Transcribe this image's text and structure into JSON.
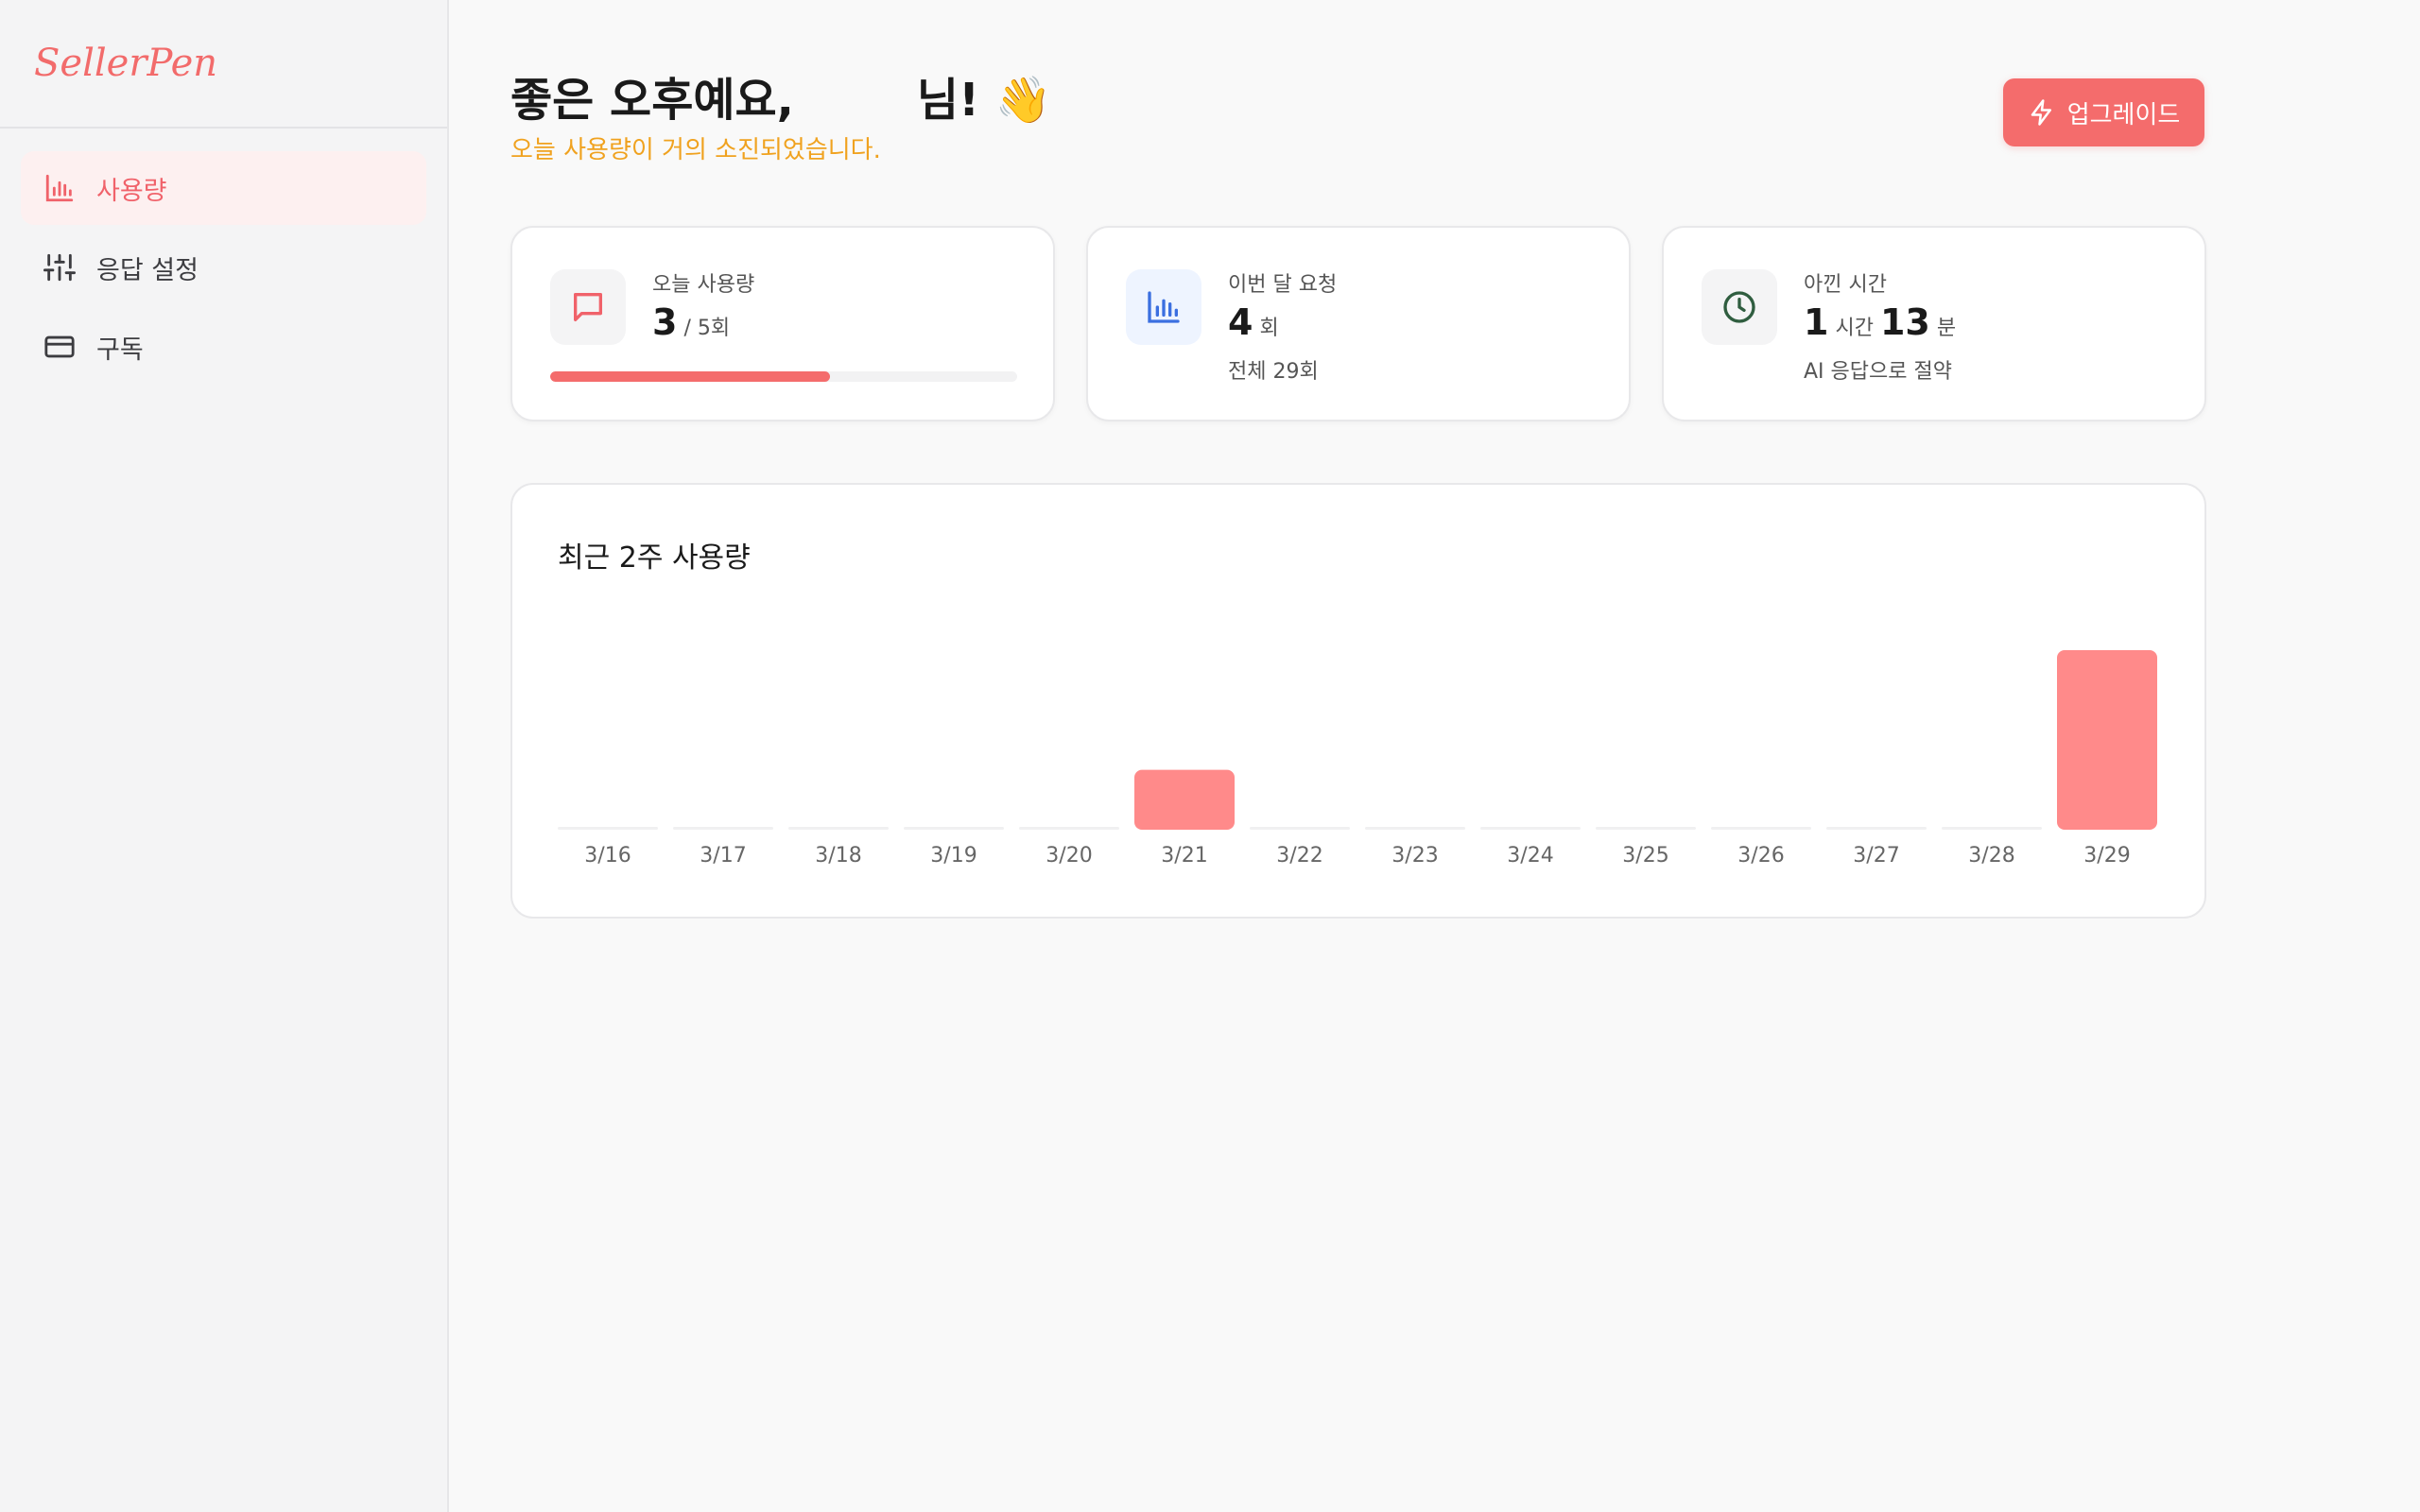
{
  "app": {
    "logo": "SellerPen"
  },
  "sidebar": {
    "items": [
      {
        "label": "사용량",
        "icon": "bar-chart-icon",
        "active": true
      },
      {
        "label": "응답 설정",
        "icon": "sliders-icon",
        "active": false
      },
      {
        "label": "구독",
        "icon": "credit-card-icon",
        "active": false
      }
    ]
  },
  "header": {
    "greeting_prefix": "좋은 오후예요,",
    "greeting_suffix": "님! 👋",
    "subtitle": "오늘 사용량이 거의 소진되었습니다.",
    "upgrade_label": "업그레이드"
  },
  "cards": {
    "today": {
      "label": "오늘 사용량",
      "value": "3",
      "limit": "/ 5회",
      "progress": 0.6
    },
    "month": {
      "label": "이번 달 요청",
      "value": "4",
      "unit": "회",
      "sub": "전체 29회"
    },
    "saved": {
      "label": "아낀 시간",
      "hours": "1",
      "hours_unit": "시간",
      "minutes": "13",
      "minutes_unit": "분",
      "sub": "AI 응답으로 절약"
    }
  },
  "colors": {
    "accent": "#f46c6c",
    "warning": "#f0a21f",
    "bar": "#ff8a8a",
    "clock": "#2f5d3f",
    "chart_icon": "#3b6fe0"
  },
  "chart_data": {
    "type": "bar",
    "title": "최근 2주 사용량",
    "categories": [
      "3/16",
      "3/17",
      "3/18",
      "3/19",
      "3/20",
      "3/21",
      "3/22",
      "3/23",
      "3/24",
      "3/25",
      "3/26",
      "3/27",
      "3/28",
      "3/29"
    ],
    "values": [
      0,
      0,
      0,
      0,
      0,
      1,
      0,
      0,
      0,
      0,
      0,
      0,
      0,
      3
    ],
    "ylim": [
      0,
      3
    ],
    "grid": false
  }
}
